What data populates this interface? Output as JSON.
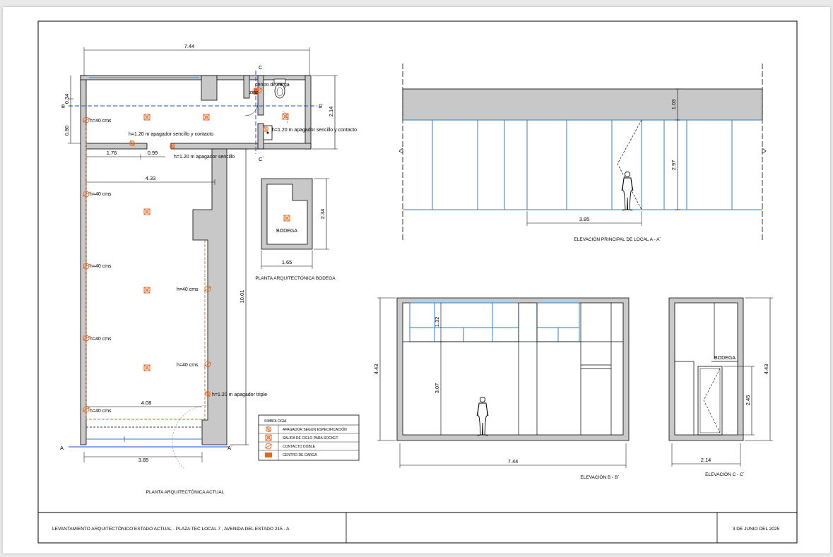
{
  "title_block": {
    "project": "LEVANTAMIENTO ARQUITECTÓNICO ESTADO ACTUAL - PLAZA TEC LOCAL 7 , AVENIDA DEL ESTADO 215 - A",
    "date": "3 DE JUNIO DEL 2025"
  },
  "plan": {
    "title": "PLANTA ARQUITECTÓNICA ACTUAL",
    "dims": {
      "top_width": "7.44",
      "bottom_width": "3.85",
      "front_width": "4.33",
      "lower_width": "4.08",
      "depth": "10.01",
      "partition_left": "1.76",
      "partition_right": "0.99",
      "left_upper": "0.34",
      "left_lower": "0.80",
      "right_side": "2.14"
    },
    "sections": {
      "a": "A",
      "a2": "A´",
      "b": "B",
      "b2": "B´",
      "c": "C",
      "c2": "C´"
    },
    "labels": {
      "panel": "centro de carga",
      "sink": "zinc",
      "switch_contact_1": "h=1.20 m apagador sencillo y contacto",
      "switch_contact_2": "h=1.20 m apagador sencillo y contacto",
      "switch_single": "h=1.20 m apagador sencillo",
      "switch_triple": "h=1.20 m apagador triple",
      "h40": "h=40 cms"
    }
  },
  "bodega": {
    "title": "PLANTA ARQUITECTÓNICA BODEGA",
    "label": "BODEGA",
    "dim_width": "1.65",
    "dim_height": "2.34"
  },
  "elev_a": {
    "title": "ELEVACIÓN PRINCIPAL DE LOCAL A - A´",
    "dim_top": "1.03",
    "dim_height": "2.97",
    "dim_width": "3.85"
  },
  "elev_b": {
    "title": "ELEVACIÓN B - B´",
    "dim_total_height": "4.43",
    "dim_upper": "1.32",
    "dim_lower": "3.07",
    "dim_width": "7.44"
  },
  "elev_c": {
    "title": "ELEVACIÓN C - C´",
    "label": "BODEGA",
    "dim_height": "4.43",
    "dim_door": "2.45",
    "dim_width": "2.14"
  },
  "legend": {
    "title": "SIMBOLOGIA",
    "items": [
      {
        "label": "APAGADOR SEGUN ESPECIFICACIÓN",
        "icon": "switch-icon"
      },
      {
        "label": "SALIDA DE CIELO PARA SOCKET",
        "icon": "ceiling-socket-icon"
      },
      {
        "label": "CONTACTO DOBLE",
        "icon": "double-outlet-icon"
      },
      {
        "label": "CENTRO DE CARGA",
        "icon": "load-center-icon"
      }
    ]
  },
  "colors": {
    "wall_fill": "#c8c8c8",
    "electrical": "#e8641e",
    "glazing": "#2e7fc4",
    "section_line": "#1f4fd6"
  }
}
